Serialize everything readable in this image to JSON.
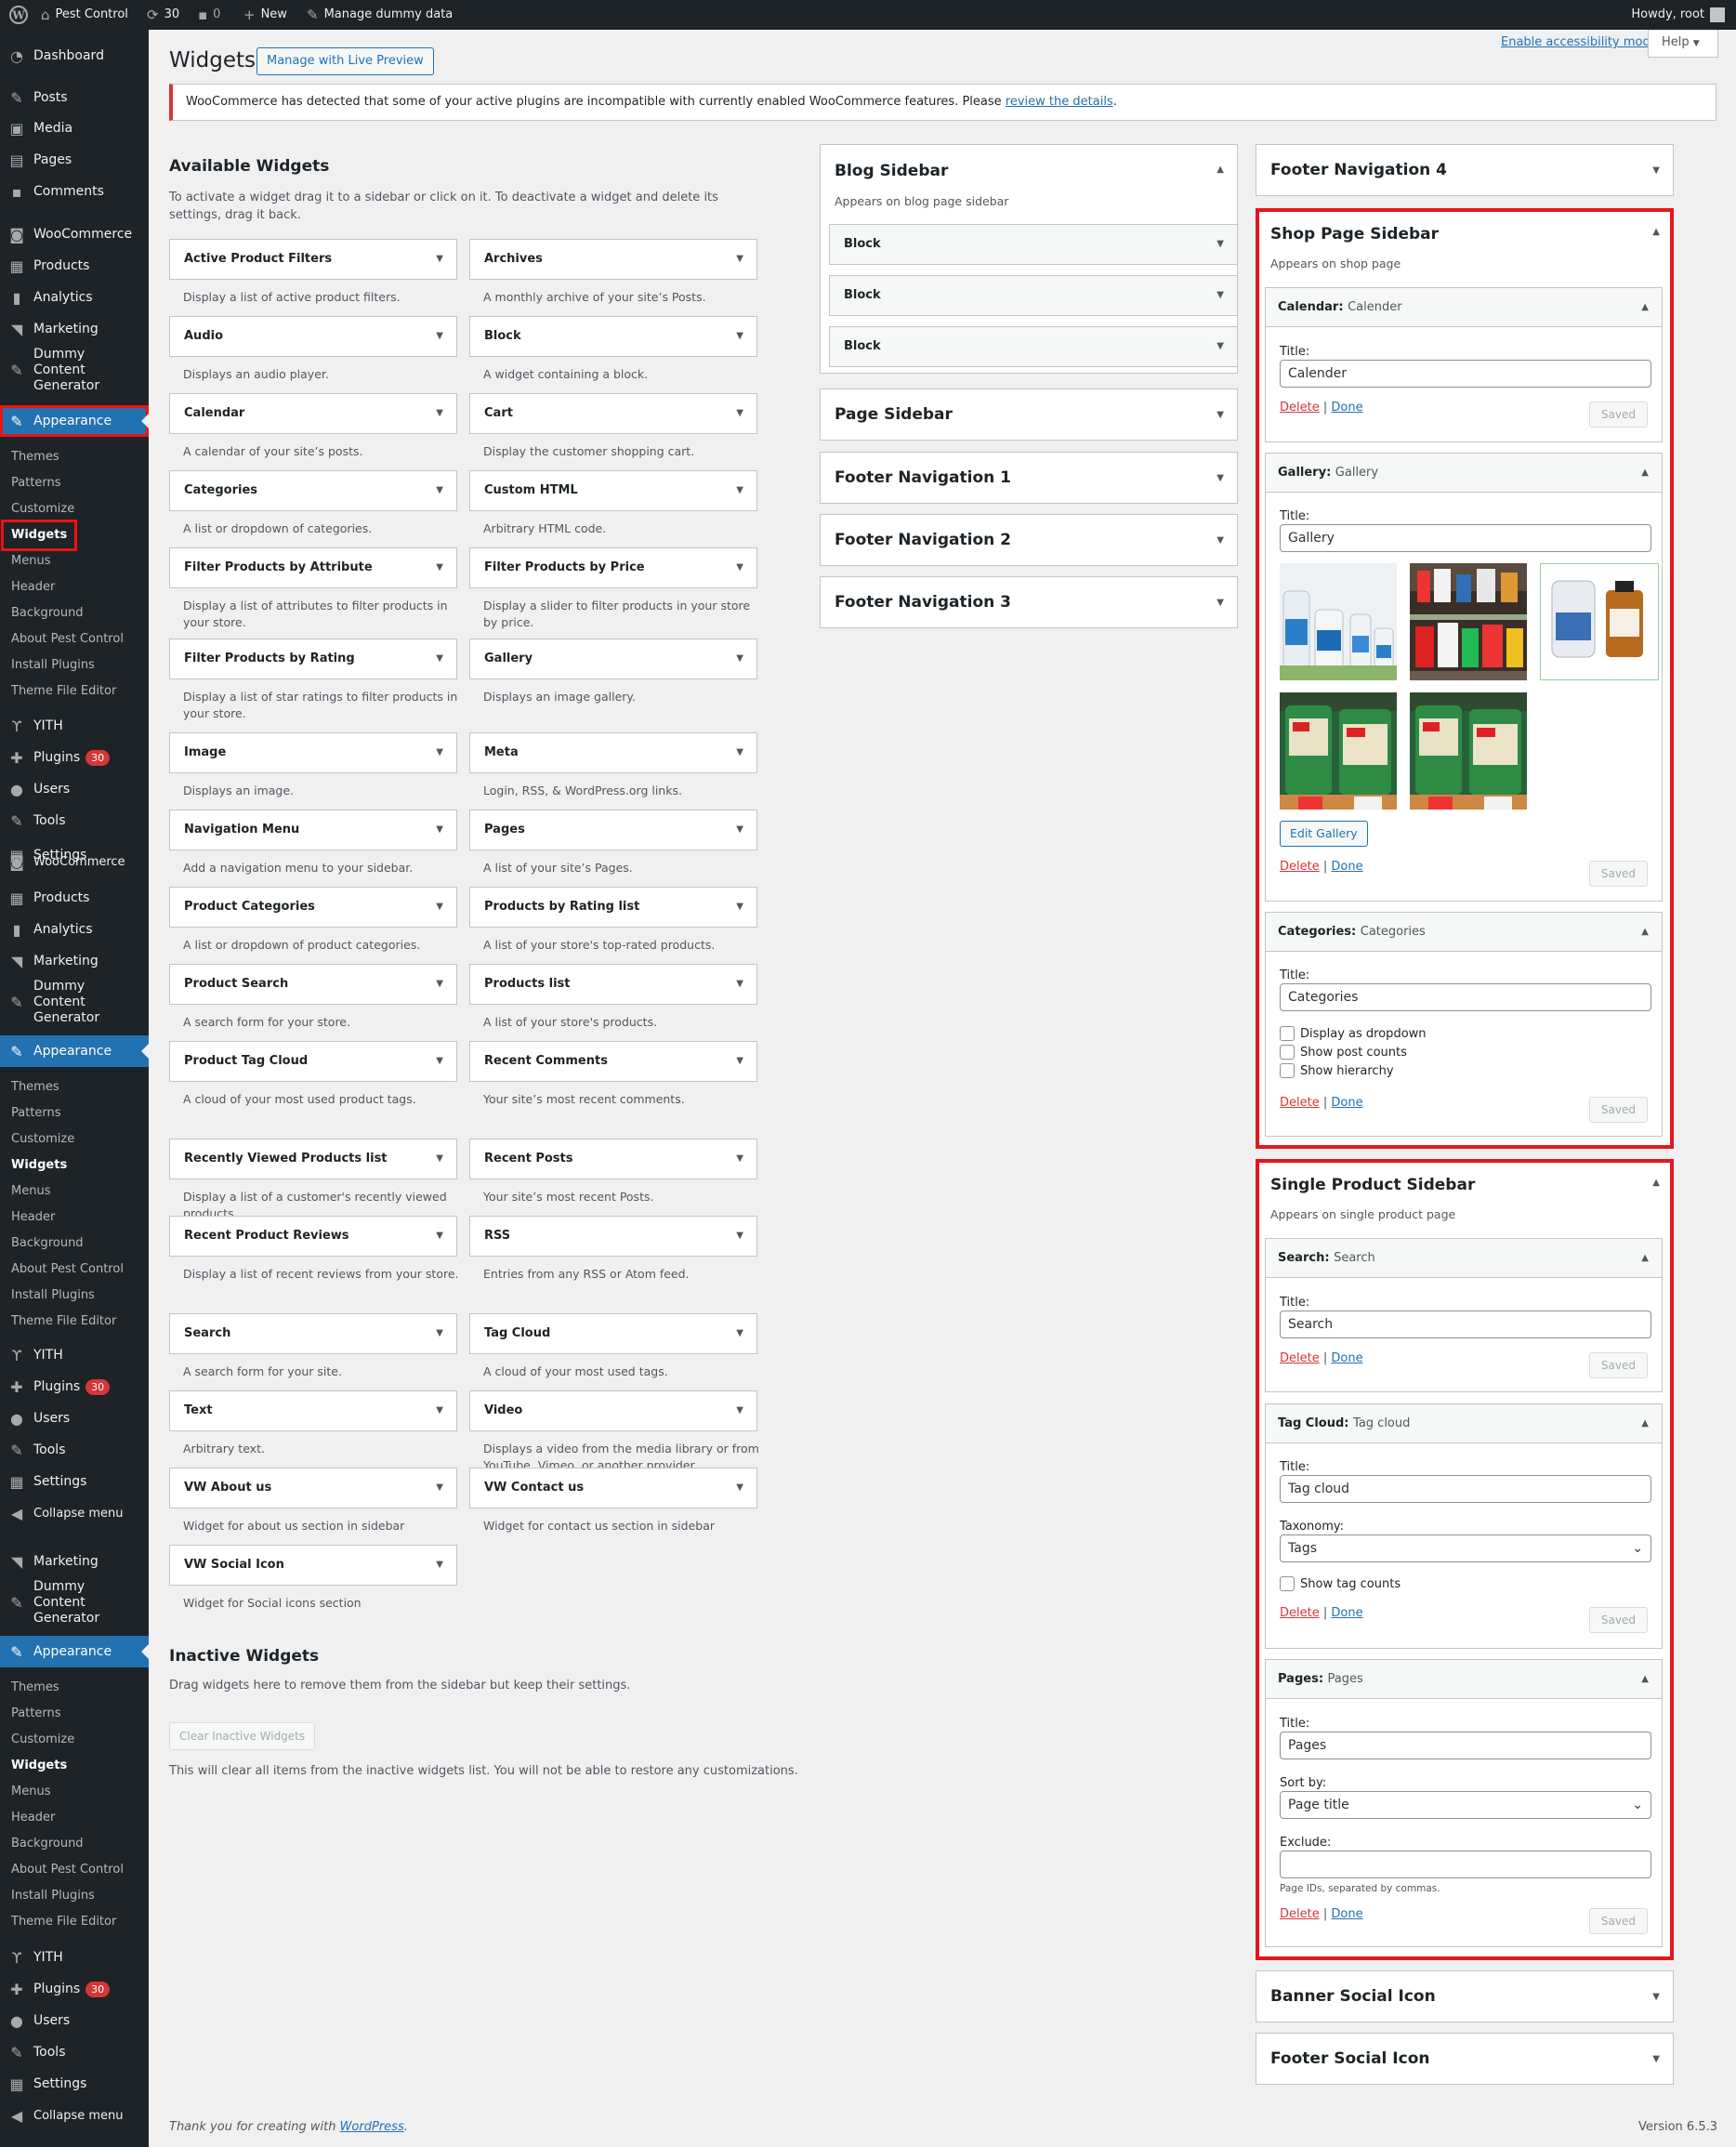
{
  "admin_bar": {
    "site": "Pest Control",
    "updates": "30",
    "comments": "0",
    "new": "New",
    "manage": "Manage dummy data",
    "howdy": "Howdy, root"
  },
  "menu": {
    "dashboard": "Dashboard",
    "posts": "Posts",
    "media": "Media",
    "pages": "Pages",
    "comments": "Comments",
    "woocommerce": "WooCommerce",
    "products": "Products",
    "analytics": "Analytics",
    "marketing": "Marketing",
    "dummy": "Dummy Content Generator",
    "appearance": "Appearance",
    "yith": "YITH",
    "plugins": "Plugins",
    "plugins_badge": "30",
    "users": "Users",
    "tools": "Tools",
    "settings": "Settings",
    "collapse": "Collapse menu",
    "sub": {
      "themes": "Themes",
      "patterns": "Patterns",
      "customize": "Customize",
      "widgets": "Widgets",
      "menus": "Menus",
      "header": "Header",
      "background": "Background",
      "about": "About Pest Control",
      "install": "Install Plugins",
      "editor": "Theme File Editor"
    }
  },
  "page": {
    "title": "Widgets",
    "live_preview": "Manage with Live Preview",
    "accessibility": "Enable accessibility mode",
    "help": "Help",
    "notice_text": "WooCommerce has detected that some of your active plugins are incompatible with currently enabled WooCommerce features. Please ",
    "notice_link": "review the details",
    "notice_end": "."
  },
  "available": {
    "title": "Available Widgets",
    "desc": "To activate a widget drag it to a sidebar or click on it. To deactivate a widget and delete its settings, drag it back.",
    "widgets": [
      {
        "name": "Active Product Filters",
        "desc": "Display a list of active product filters."
      },
      {
        "name": "Archives",
        "desc": "A monthly archive of your site’s Posts."
      },
      {
        "name": "Audio",
        "desc": "Displays an audio player."
      },
      {
        "name": "Block",
        "desc": "A widget containing a block."
      },
      {
        "name": "Calendar",
        "desc": "A calendar of your site’s posts."
      },
      {
        "name": "Cart",
        "desc": "Display the customer shopping cart."
      },
      {
        "name": "Categories",
        "desc": "A list or dropdown of categories."
      },
      {
        "name": "Custom HTML",
        "desc": "Arbitrary HTML code."
      },
      {
        "name": "Filter Products by Attribute",
        "desc": "Display a list of attributes to filter products in your store."
      },
      {
        "name": "Filter Products by Price",
        "desc": "Display a slider to filter products in your store by price."
      },
      {
        "name": "Filter Products by Rating",
        "desc": "Display a list of star ratings to filter products in your store."
      },
      {
        "name": "Gallery",
        "desc": "Displays an image gallery."
      },
      {
        "name": "Image",
        "desc": "Displays an image."
      },
      {
        "name": "Meta",
        "desc": "Login, RSS, & WordPress.org links."
      },
      {
        "name": "Navigation Menu",
        "desc": "Add a navigation menu to your sidebar."
      },
      {
        "name": "Pages",
        "desc": "A list of your site’s Pages."
      },
      {
        "name": "Product Categories",
        "desc": "A list or dropdown of product categories."
      },
      {
        "name": "Products by Rating list",
        "desc": "A list of your store's top-rated products."
      },
      {
        "name": "Product Search",
        "desc": "A search form for your store."
      },
      {
        "name": "Products list",
        "desc": "A list of your store's products."
      },
      {
        "name": "Product Tag Cloud",
        "desc": "A cloud of your most used product tags."
      },
      {
        "name": "Recent Comments",
        "desc": "Your site’s most recent comments."
      },
      {
        "name": "Recently Viewed Products list",
        "desc": "Display a list of a customer's recently viewed products."
      },
      {
        "name": "Recent Posts",
        "desc": "Your site’s most recent Posts."
      },
      {
        "name": "Recent Product Reviews",
        "desc": "Display a list of recent reviews from your store."
      },
      {
        "name": "RSS",
        "desc": "Entries from any RSS or Atom feed."
      },
      {
        "name": "Search",
        "desc": "A search form for your site."
      },
      {
        "name": "Tag Cloud",
        "desc": "A cloud of your most used tags."
      },
      {
        "name": "Text",
        "desc": "Arbitrary text."
      },
      {
        "name": "Video",
        "desc": "Displays a video from the media library or from YouTube, Vimeo, or another provider."
      },
      {
        "name": "VW About us",
        "desc": "Widget for about us section in sidebar"
      },
      {
        "name": "VW Contact us",
        "desc": "Widget for contact us section in sidebar"
      },
      {
        "name": "VW Social Icon",
        "desc": "Widget for Social icons section"
      }
    ]
  },
  "inactive": {
    "title": "Inactive Widgets",
    "desc": "Drag widgets here to remove them from the sidebar but keep their settings.",
    "clear": "Clear Inactive Widgets",
    "note": "This will clear all items from the inactive widgets list. You will not be able to restore any customizations."
  },
  "sidebars": {
    "blog": {
      "title": "Blog Sidebar",
      "desc": "Appears on blog page sidebar",
      "blocks": [
        "Block",
        "Block",
        "Block"
      ]
    },
    "page": {
      "title": "Page Sidebar"
    },
    "fn1": {
      "title": "Footer Navigation 1"
    },
    "fn2": {
      "title": "Footer Navigation 2"
    },
    "fn3": {
      "title": "Footer Navigation 3"
    },
    "fn4": {
      "title": "Footer Navigation 4"
    },
    "shop": {
      "title": "Shop Page Sidebar",
      "desc": "Appears on shop page"
    },
    "single": {
      "title": "Single Product Sidebar",
      "desc": "Appears on single product page"
    },
    "banner": {
      "title": "Banner Social Icon"
    },
    "footer_social": {
      "title": "Footer Social Icon"
    }
  },
  "widget_forms": {
    "title_label": "Title:",
    "delete": "Delete",
    "sep": "|",
    "done": "Done",
    "saved": "Saved",
    "calendar": {
      "type": "Calendar",
      "sep": ":",
      "inst": "Calender",
      "value": "Calender"
    },
    "gallery": {
      "type": "Gallery",
      "inst": "Gallery",
      "value": "Gallery",
      "edit": "Edit Gallery"
    },
    "categories": {
      "type": "Categories",
      "inst": "Categories",
      "value": "Categories",
      "opt1": "Display as dropdown",
      "opt2": "Show post counts",
      "opt3": "Show hierarchy"
    },
    "search": {
      "type": "Search",
      "inst": "Search",
      "value": "Search"
    },
    "tagcloud": {
      "type": "Tag Cloud",
      "inst": "Tag cloud",
      "value": "Tag cloud",
      "tax_label": "Taxonomy:",
      "tax_value": "Tags",
      "show_counts": "Show tag counts"
    },
    "pages": {
      "type": "Pages",
      "inst": "Pages",
      "value": "Pages",
      "sort_label": "Sort by:",
      "sort_value": "Page title",
      "exclude_label": "Exclude:",
      "exclude_value": "",
      "exclude_help": "Page IDs, separated by commas."
    }
  },
  "footer": {
    "thanks": "Thank you for creating with ",
    "wp": "WordPress",
    "dot": ".",
    "version": "Version 6.5.3"
  }
}
